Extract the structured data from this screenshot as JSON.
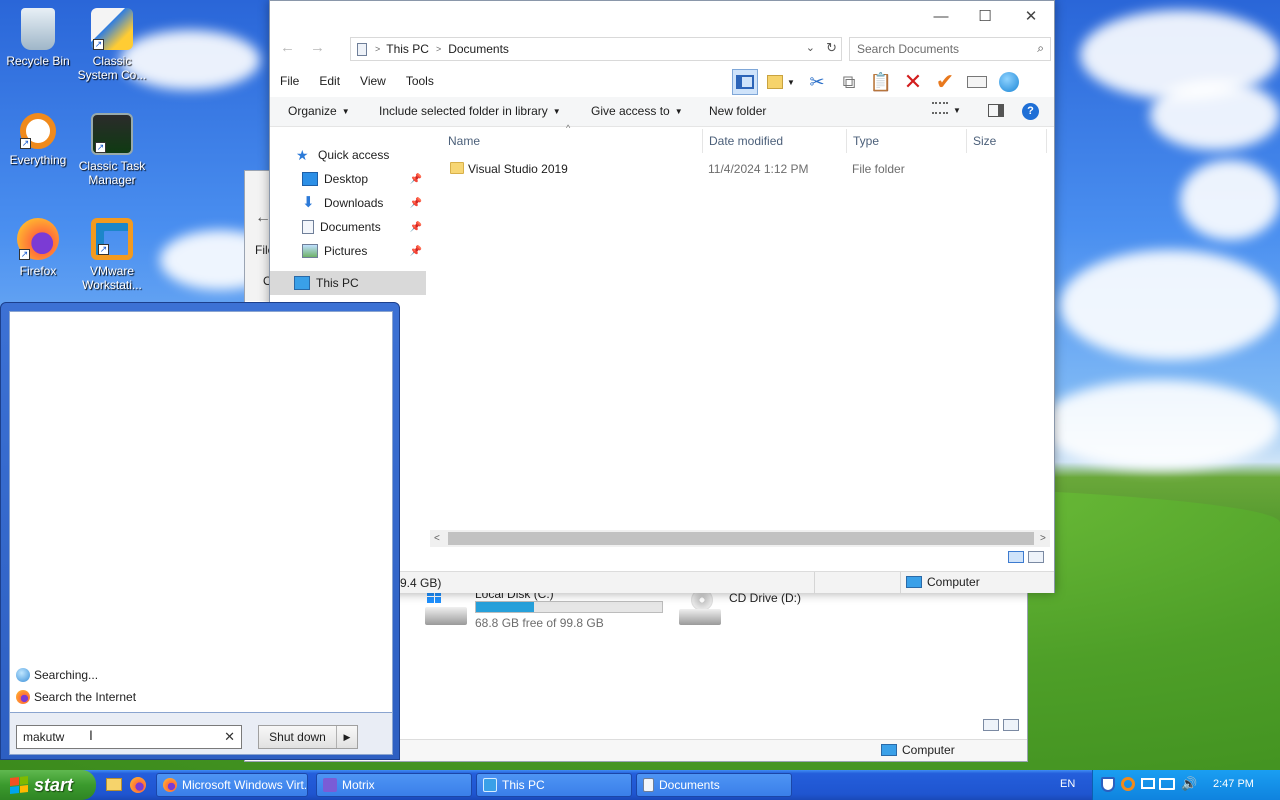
{
  "desktop": {
    "icons": [
      {
        "label": "Recycle Bin"
      },
      {
        "label": "Classic System Co..."
      },
      {
        "label": "Everything"
      },
      {
        "label": "Classic Task Manager"
      },
      {
        "label": "Firefox"
      },
      {
        "label": "VMware Workstati..."
      }
    ]
  },
  "back_window": {
    "menu_fragment": "File",
    "item_fragment": "O",
    "drives": [
      {
        "name": "Local Disk (C:)",
        "free": "68.8 GB free of 99.8 GB",
        "used_fraction": 0.31
      },
      {
        "name": "CD Drive (D:)"
      }
    ],
    "status_location": "Computer"
  },
  "explorer": {
    "title_buttons": {
      "minimize": "—",
      "maximize": "☐",
      "close": "✕"
    },
    "address": {
      "root": "This PC",
      "folder": "Documents"
    },
    "search_placeholder": "Search Documents",
    "menu": [
      "File",
      "Edit",
      "View",
      "Tools"
    ],
    "commands": {
      "organize": "Organize",
      "include": "Include selected folder in library",
      "give_access": "Give access to",
      "new_folder": "New folder"
    },
    "nav": {
      "quick_access": "Quick access",
      "desktop": "Desktop",
      "downloads": "Downloads",
      "documents": "Documents",
      "pictures": "Pictures",
      "this_pc": "This PC"
    },
    "columns": {
      "name": "Name",
      "date": "Date modified",
      "type": "Type",
      "size": "Size"
    },
    "files": [
      {
        "name": "Visual Studio 2019",
        "date": "11/4/2024 1:12 PM",
        "type": "File folder"
      }
    ],
    "status_left": "9.4 GB)",
    "status_location": "Computer"
  },
  "start_menu": {
    "searching": "Searching...",
    "search_internet": "Search the Internet",
    "search_value": "makutw",
    "clear": "✕",
    "shutdown": "Shut down"
  },
  "taskbar": {
    "start_label": "start",
    "items": [
      {
        "label": "Microsoft Windows Virt..."
      },
      {
        "label": "Motrix"
      },
      {
        "label": "This PC"
      },
      {
        "label": "Documents"
      }
    ],
    "language": "EN",
    "clock": "2:47 PM"
  },
  "colors": {
    "xp_blue": "#245edb",
    "start_green": "#3b9a2d",
    "accent": "#26a0da"
  }
}
